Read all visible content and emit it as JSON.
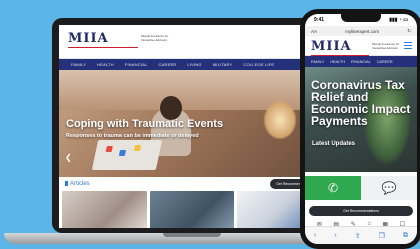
{
  "brand": {
    "logo_text": "MIIA",
    "tagline": "Mutual Insurance for Interactive Advisors"
  },
  "laptop": {
    "nav_items": [
      "FAMILY",
      "HEALTH",
      "FINANCIAL",
      "CAREER",
      "LIVING",
      "MILITARY",
      "COLLEGE LIFE"
    ],
    "hero_title": "Coping with Traumatic Events",
    "hero_subtitle": "Responses to trauma can be immediate or delayed",
    "articles_label": "Articles",
    "recommendations_button": "Get Recommendations!"
  },
  "phone": {
    "status_time": "9:41",
    "status_icons": "▮▮▮ ◔ ▭",
    "url": "myliteexpert.com",
    "nav_items": [
      "FAMILY",
      "HEALTH",
      "FINANCIAL",
      "CAREER"
    ],
    "hero_title": "Coronavirus Tax Relief and Economic Impact Payments",
    "hero_subtitle": "Latest Updates",
    "recommendations_button": "Get Recommendations",
    "tools": [
      "✉",
      "▤",
      "✎",
      "⌂",
      "▦",
      "☐"
    ],
    "bottom_bar": [
      "‹",
      "›",
      "⇪",
      "❐",
      "⧉"
    ]
  },
  "colors": {
    "background": "#5bb5e6",
    "nav": "#24307a",
    "brand": "#232a63",
    "accent": "#2c7bd6",
    "call": "#2fa84f"
  }
}
